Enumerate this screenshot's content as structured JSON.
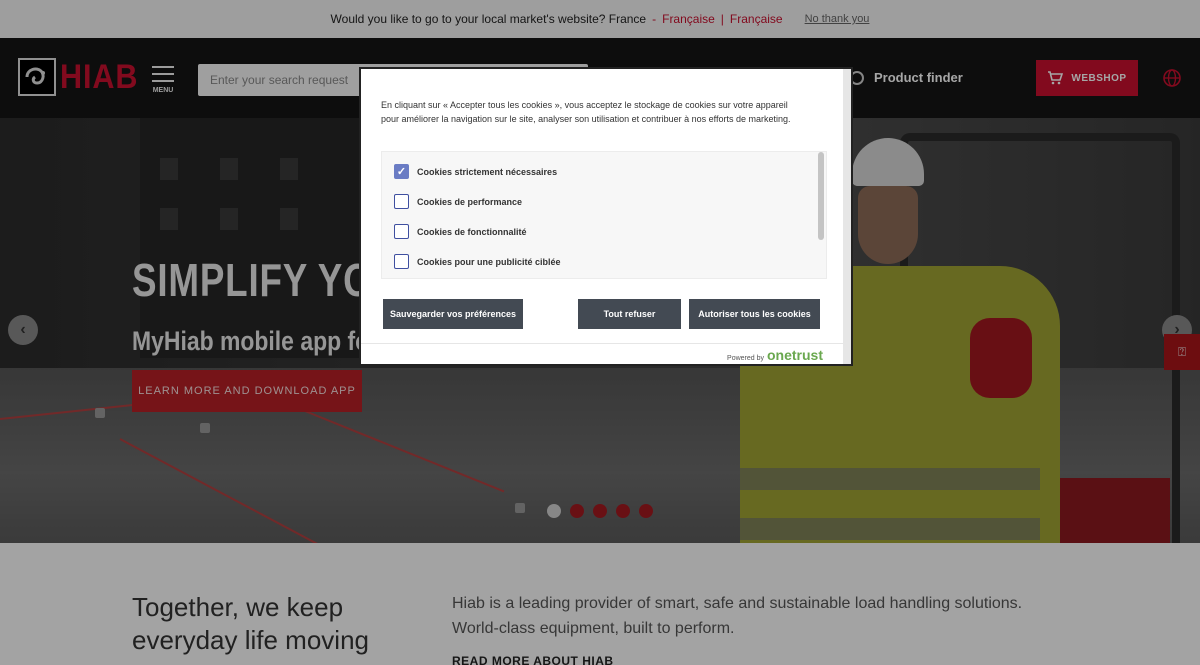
{
  "market_bar": {
    "question": "Would you like to go to your local market's website? France",
    "lang1": "Française",
    "lang2": "Française",
    "no_thanks": "No thank you"
  },
  "header": {
    "logo_text": "HIAB",
    "menu_label": "MENU",
    "search_placeholder": "Enter your search request",
    "product_finder": "Product finder",
    "webshop": "WEBSHOP"
  },
  "hero": {
    "title": "SIMPLIFY YOU",
    "subtitle": "MyHiab mobile app fo",
    "cta": "LEARN MORE AND DOWNLOAD APP",
    "slide_count": 5,
    "active_slide": 1
  },
  "about": {
    "heading": "Together, we keep everyday life moving",
    "paragraph": "Hiab is a leading provider of smart, safe and sustainable load handling solutions. World-class equipment, built to perform.",
    "link": "READ MORE ABOUT HIAB"
  },
  "cookie_modal": {
    "text": "En cliquant sur « Accepter tous les cookies », vous acceptez le stockage de cookies sur votre appareil pour améliorer la navigation sur le site, analyser son utilisation et contribuer à nos efforts de marketing.",
    "options": [
      {
        "label": "Cookies strictement nécessaires",
        "checked": true
      },
      {
        "label": "Cookies de performance",
        "checked": false
      },
      {
        "label": "Cookies de fonctionnalité",
        "checked": false
      },
      {
        "label": "Cookies pour une publicité ciblée",
        "checked": false
      }
    ],
    "save_button": "Sauvegarder vos préférences",
    "reject_button": "Tout refuser",
    "accept_button": "Autoriser tous les cookies",
    "powered_by": "Powered by",
    "brand": "onetrust"
  },
  "colors": {
    "brand_red": "#c8102e",
    "button_dark": "#434a53",
    "checkbox_blue": "#6a7cc4"
  }
}
